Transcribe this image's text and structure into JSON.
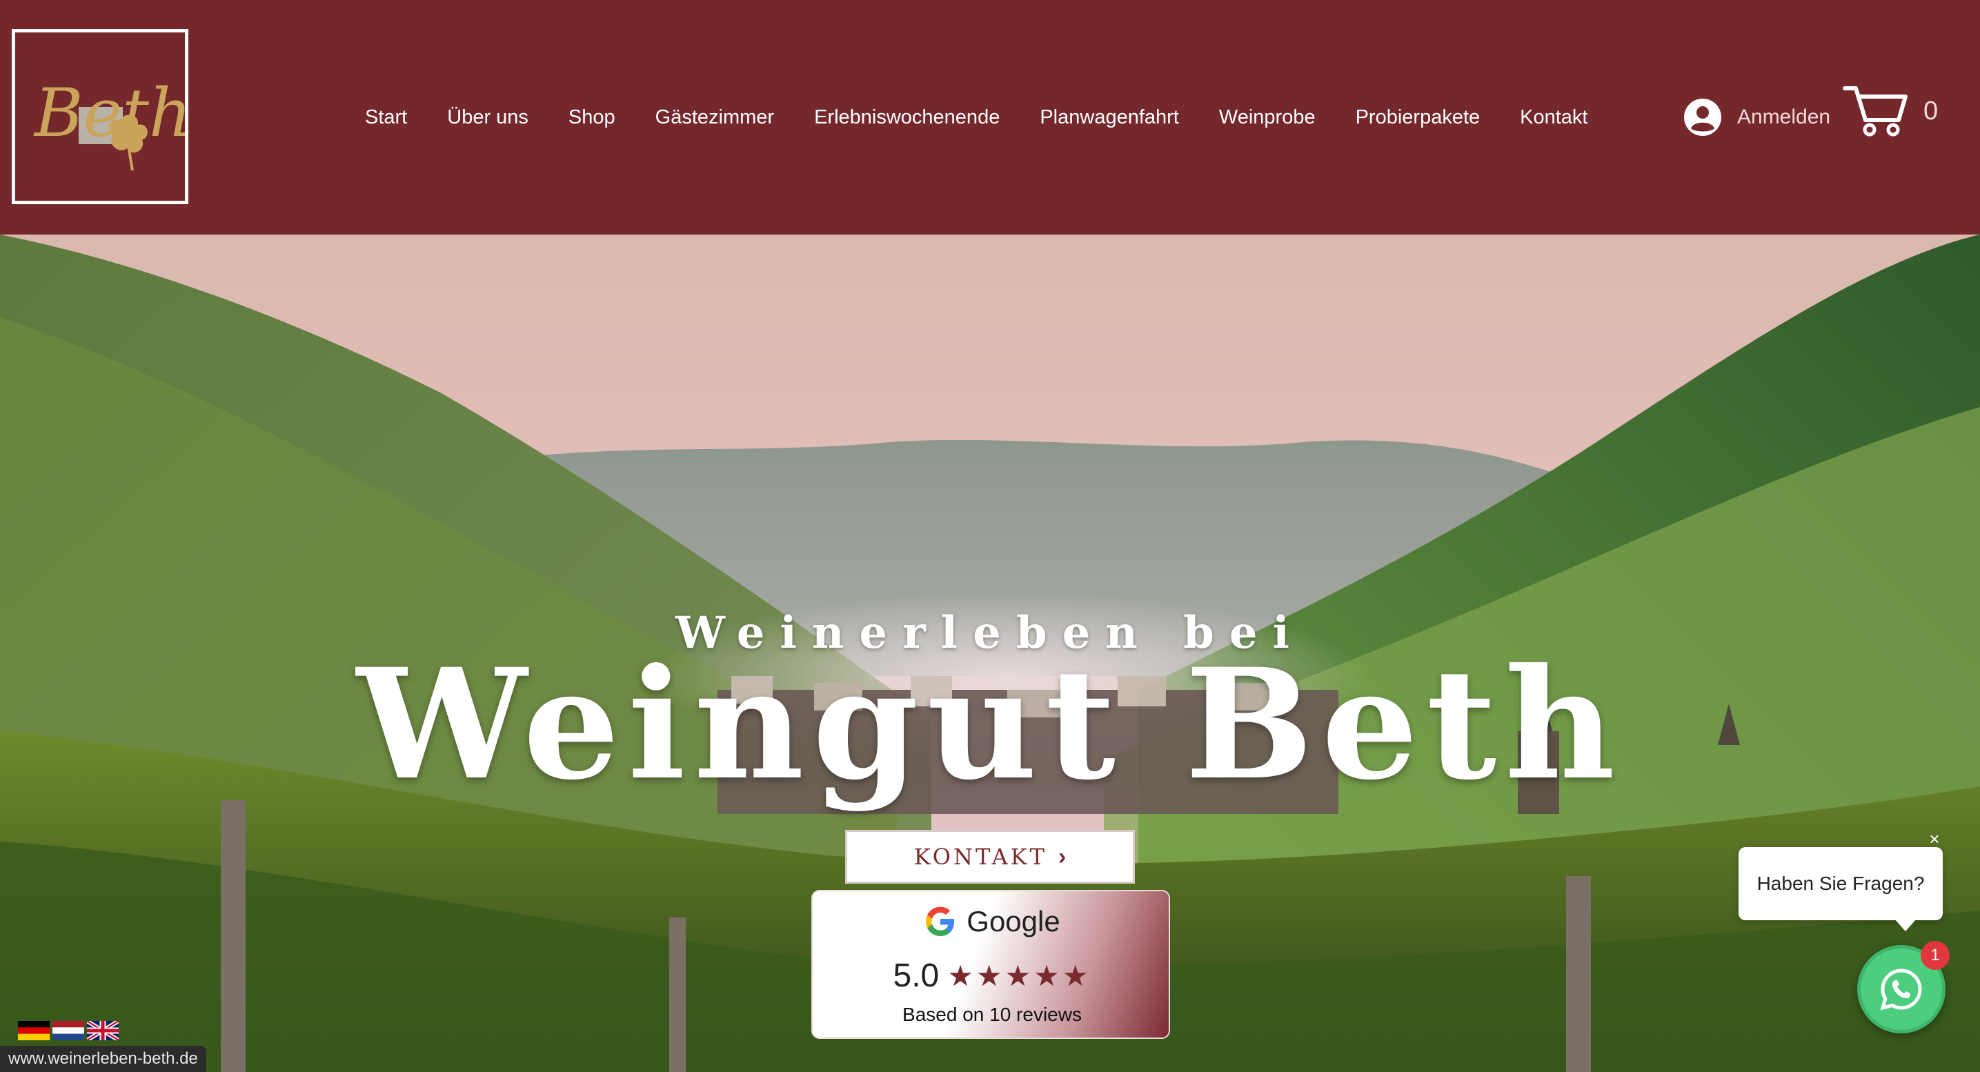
{
  "header": {
    "logo_text": "Beth",
    "nav": [
      "Start",
      "Über uns",
      "Shop",
      "Gästezimmer",
      "Erlebniswochenende",
      "Planwagenfahrt",
      "Weinprobe",
      "Probierpakete",
      "Kontakt"
    ],
    "login_label": "Anmelden",
    "cart_count": "0"
  },
  "hero": {
    "subtitle": "Weinerleben bei",
    "title": "Weingut Beth",
    "cta_label": "KONTAKT",
    "cta_icon": "chevron-right-icon"
  },
  "review": {
    "provider": "Google",
    "score": "5.0",
    "stars": 5,
    "based_on": "Based on 10 reviews"
  },
  "chat": {
    "prompt": "Haben Sie Fragen?",
    "badge_count": "1",
    "icon": "whatsapp-icon"
  },
  "languages": [
    "de",
    "nl",
    "en"
  ],
  "status_bar": {
    "url": "www.weinerleben-beth.de"
  },
  "colors": {
    "brand": "#74282c",
    "gold": "#c9a45a",
    "whatsapp": "#4dcd7e"
  }
}
